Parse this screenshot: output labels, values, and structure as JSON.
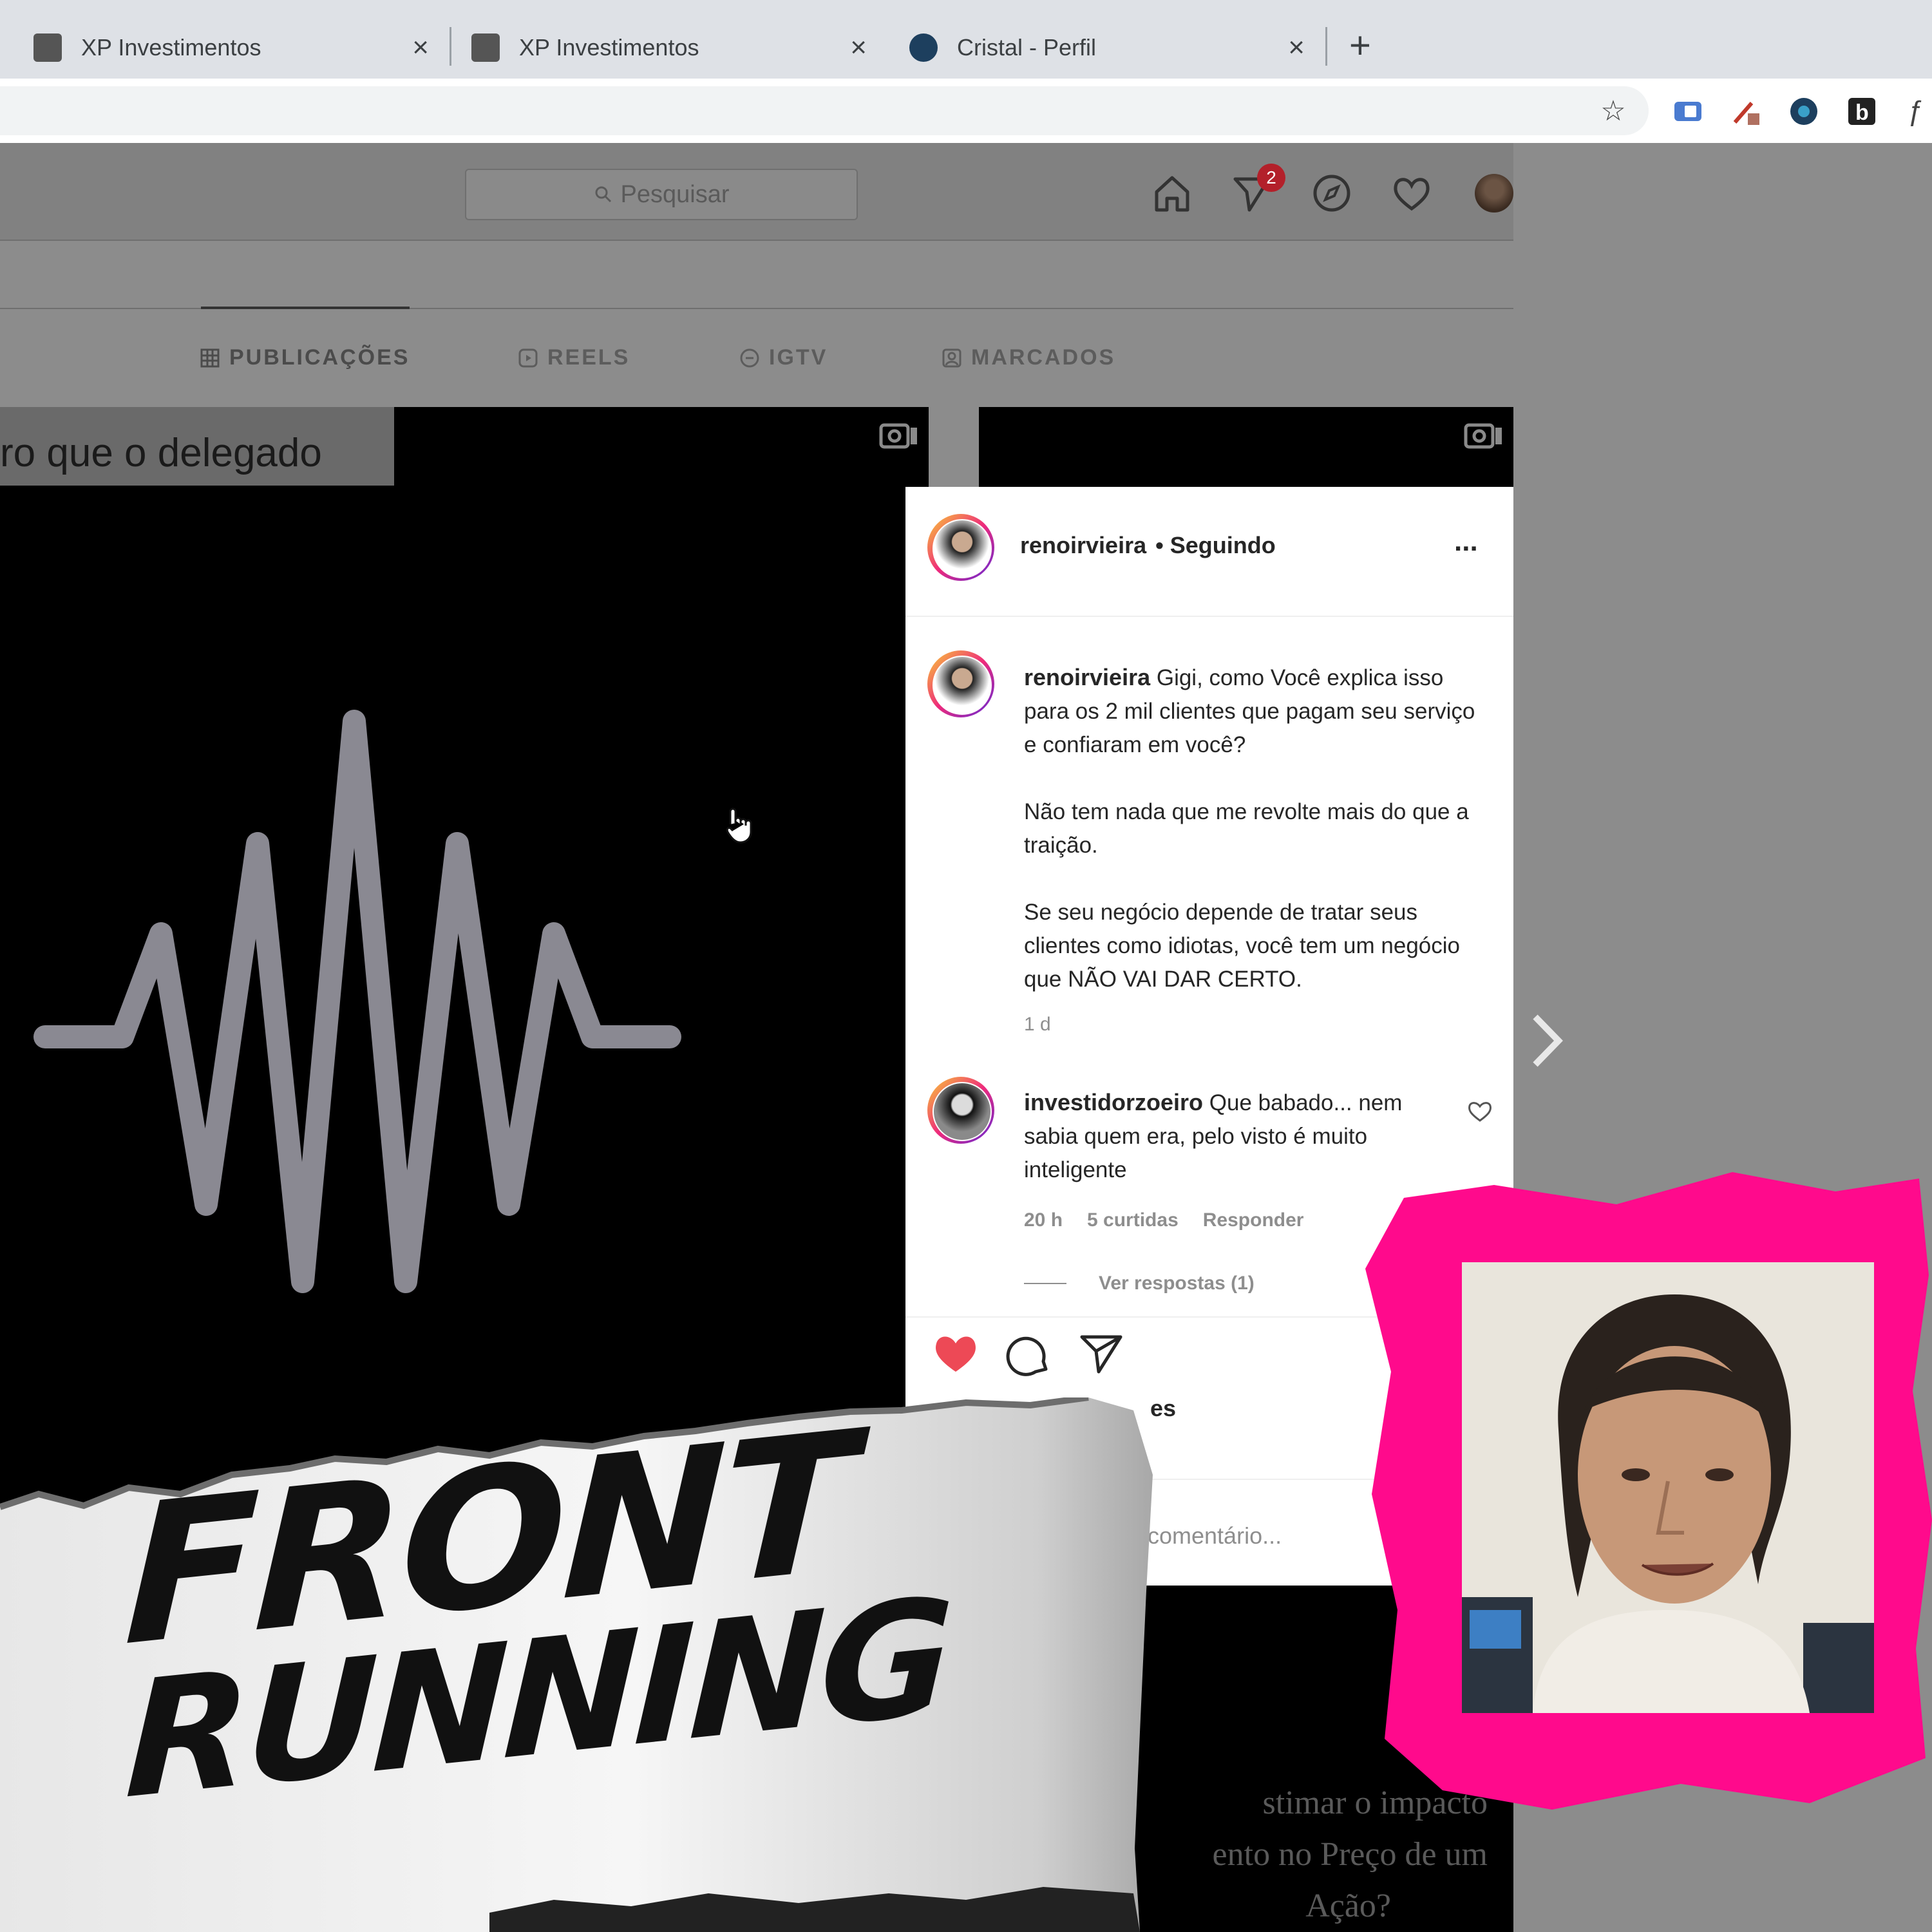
{
  "browser": {
    "tabs": [
      {
        "title": "XP Investimentos",
        "close": "×"
      },
      {
        "title": "XP Investimentos",
        "close": "×"
      },
      {
        "title": "Cristal - Perfil",
        "close": "×"
      }
    ],
    "new_tab": "+"
  },
  "instagram": {
    "search_placeholder": "Pesquisar",
    "notification_count": "2",
    "profile_tabs": [
      "PUBLICAÇÕES",
      "REELS",
      "IGTV",
      "MARCADOS"
    ],
    "tile_caption": "ro que o delegado",
    "tile2_text_line1": "stimar o impacto",
    "tile2_text_line2": "ento no Preço de um",
    "tile2_text_line3": "Ação?",
    "post": {
      "author": "renoirvieira",
      "follow_status": "• Seguindo",
      "more": "...",
      "caption_author": "renoirvieira",
      "caption_p1": "Gigi, como Você explica isso para os 2 mil clientes que pagam seu serviço e confiaram em você?",
      "caption_p2": "Não tem nada que me revolte mais do que a traição.",
      "caption_p3": "Se seu negócio depende de tratar seus clientes como idiotas, você tem um negócio que NÃO VAI DAR CERTO.",
      "caption_time": "1 d",
      "comment": {
        "author": "investidorzoeiro",
        "text": "Que babado... nem sabia quem era, pelo visto é muito inteligente",
        "time": "20 h",
        "likes": "5 curtidas",
        "reply": "Responder",
        "view_replies": "Ver respostas (1)"
      },
      "likes_partial": "es",
      "comment_placeholder": "comentário..."
    }
  },
  "overlay": {
    "title_line1": "FRONT",
    "title_line2": "RUNNING"
  },
  "colors": {
    "accent_pink": "#ff0a8c",
    "like_red": "#ed4956"
  }
}
